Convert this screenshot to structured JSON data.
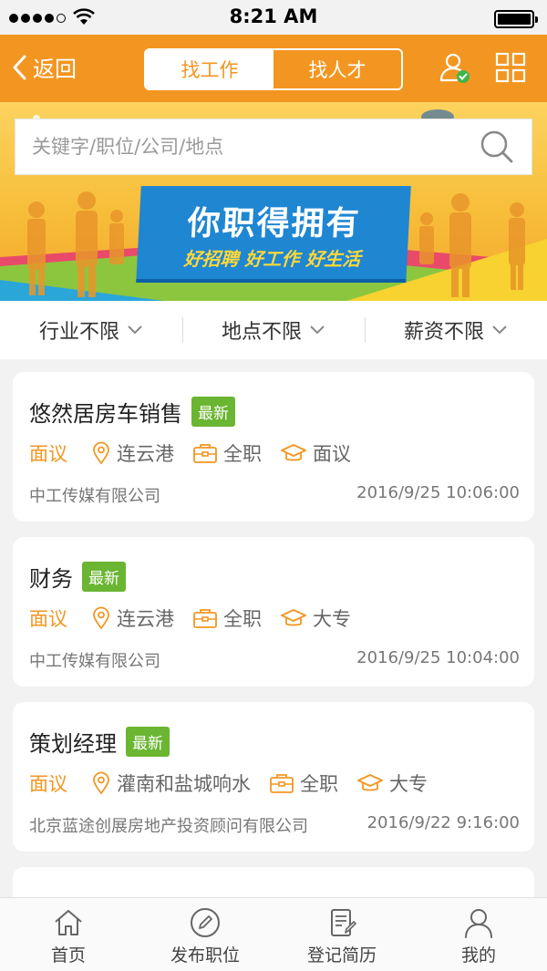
{
  "status_bar": {
    "time": "8:21 AM",
    "signal_bars": 4,
    "battery_level": 1.0
  },
  "header": {
    "back_label": "返回",
    "tabs": [
      {
        "label": "找工作",
        "active": true
      },
      {
        "label": "找人才",
        "active": false
      }
    ],
    "icons": [
      "user-verified-icon",
      "grid-icon"
    ]
  },
  "banner": {
    "search_placeholder": "关键字/职位/公司/地点",
    "slogan_main": "你职得拥有",
    "slogan_sub": "好招聘 好工作 好生活"
  },
  "filters": [
    {
      "label": "行业不限"
    },
    {
      "label": "地点不限"
    },
    {
      "label": "薪资不限"
    }
  ],
  "jobs": [
    {
      "title": "悠然居房车销售",
      "badge": "最新",
      "salary": "面议",
      "location": "连云港",
      "type": "全职",
      "education": "面议",
      "company": "中工传媒有限公司",
      "date": "2016/9/25 10:06:00"
    },
    {
      "title": "财务",
      "badge": "最新",
      "salary": "面议",
      "location": "连云港",
      "type": "全职",
      "education": "大专",
      "company": "中工传媒有限公司",
      "date": "2016/9/25 10:04:00"
    },
    {
      "title": "策划经理",
      "badge": "最新",
      "salary": "面议",
      "location": "灌南和盐城响水",
      "type": "全职",
      "education": "大专",
      "company": "北京蓝途创展房地产投资顾问有限公司",
      "date": "2016/9/22 9:16:00"
    }
  ],
  "tabbar": [
    {
      "label": "首页",
      "icon": "home-icon"
    },
    {
      "label": "发布职位",
      "icon": "edit-icon"
    },
    {
      "label": "登记简历",
      "icon": "resume-icon"
    },
    {
      "label": "我的",
      "icon": "person-icon"
    }
  ],
  "colors": {
    "accent": "#f39621",
    "badge": "#6ab531",
    "banner_sign": "#1f86d2"
  }
}
